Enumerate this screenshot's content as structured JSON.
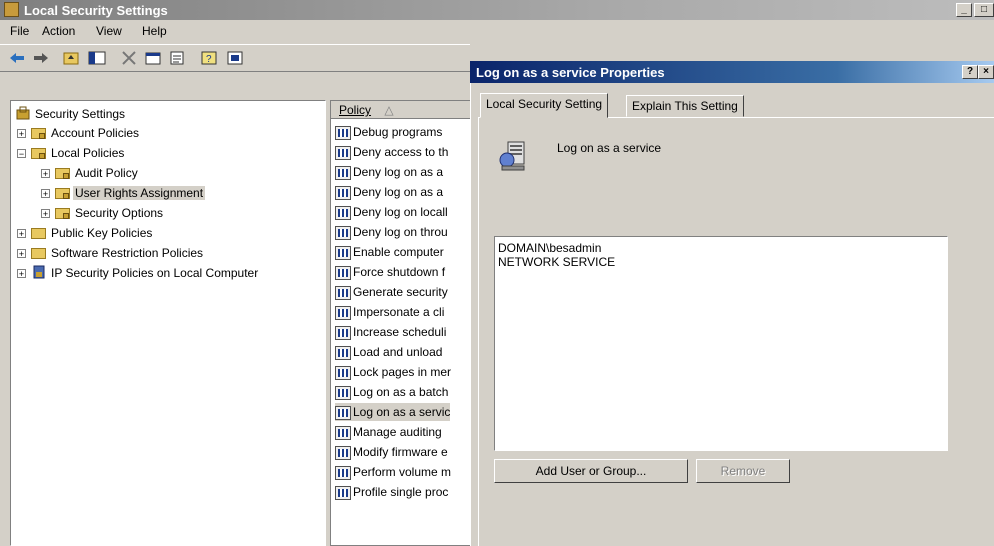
{
  "window": {
    "title": "Local Security Settings"
  },
  "menu": [
    "File",
    "Action",
    "View",
    "Help"
  ],
  "menu_underline": [
    "F",
    "A",
    "V",
    "H"
  ],
  "toolbar_icons": [
    "back-icon",
    "forward-icon",
    "up-folder-icon",
    "show-tree-icon",
    "delete-icon",
    "properties-icon",
    "export-list-icon",
    "help-icon",
    "console-icon"
  ],
  "tree": {
    "root": "Security Settings",
    "nodes": [
      {
        "label": "Account Policies"
      },
      {
        "label": "Local Policies"
      },
      {
        "label": "Audit Policy"
      },
      {
        "label": "User Rights Assignment"
      },
      {
        "label": "Security Options"
      },
      {
        "label": "Public Key Policies"
      },
      {
        "label": "Software Restriction Policies"
      },
      {
        "label": "IP Security Policies on Local Computer"
      }
    ]
  },
  "list": {
    "header": "Policy",
    "sort_indicator": "△",
    "items": [
      "Debug programs",
      "Deny access to th",
      "Deny log on as a",
      "Deny log on as a",
      "Deny log on locall",
      "Deny log on throu",
      "Enable computer",
      "Force shutdown f",
      "Generate security",
      "Impersonate a cli",
      "Increase scheduli",
      "Load and unload",
      "Lock pages in mer",
      "Log on as a batch",
      "Log on as a servic",
      "Manage auditing",
      "Modify firmware e",
      "Perform volume m",
      "Profile single proc"
    ]
  },
  "dialog": {
    "title": "Log on as a service Properties",
    "help_btn": "?",
    "close_btn": "×",
    "tabs": [
      "Local Security Setting",
      "Explain This Setting"
    ],
    "policy_name": "Log on as a service",
    "users": [
      "DOMAIN\\besadmin",
      "NETWORK SERVICE"
    ],
    "add_button": "Add User or Group...",
    "remove_button": "Remove"
  },
  "colors": {
    "dialog_title": "#0a246a",
    "main_title_inactive": "#808080"
  }
}
